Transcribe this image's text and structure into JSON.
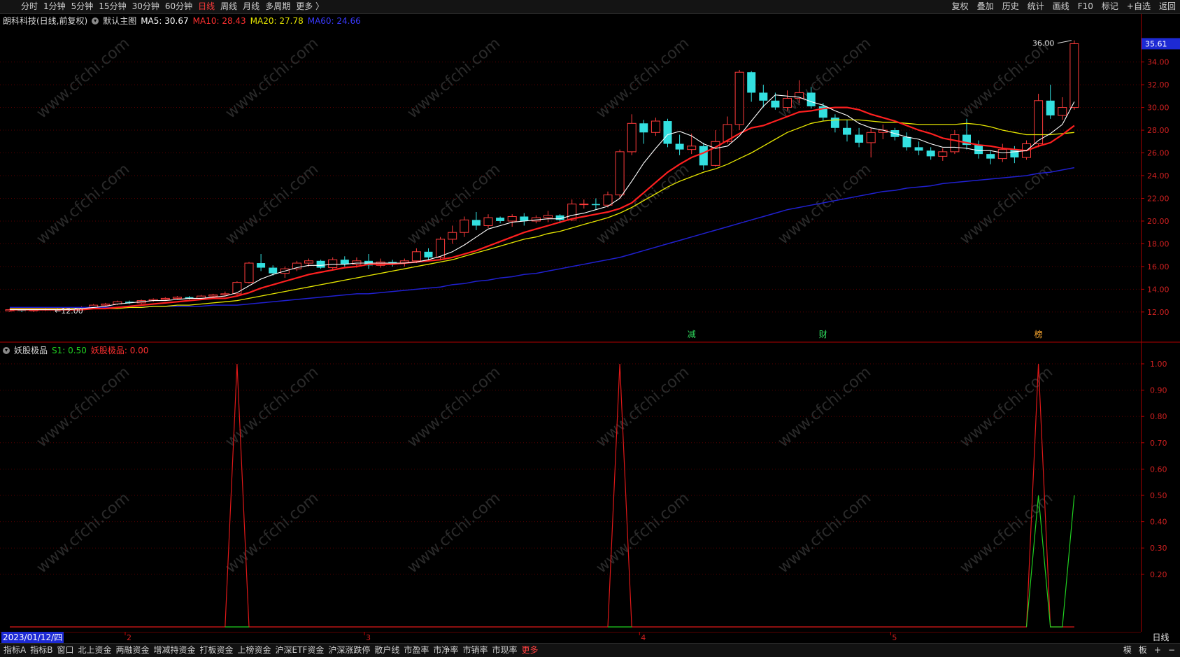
{
  "toolbar": {
    "periods": [
      "分时",
      "1分钟",
      "5分钟",
      "15分钟",
      "30分钟",
      "60分钟",
      "日线",
      "周线",
      "月线",
      "多周期",
      "更多 〉"
    ],
    "active_period": "日线",
    "actions": [
      "复权",
      "叠加",
      "历史",
      "统计",
      "画线",
      "F10",
      "标记",
      "+自选",
      "返回"
    ]
  },
  "main_header": {
    "stock": "朗科科技(日线,前复权)",
    "template": "默认主图",
    "ma5": "MA5: 30.67",
    "ma10": "MA10: 28.43",
    "ma20": "MA20: 27.78",
    "ma60": "MA60: 24.66"
  },
  "sub_header": {
    "name": "妖股极品",
    "s1": "S1: 0.50",
    "signal": "妖股极品: 0.00"
  },
  "price_axis": {
    "current": "35.61",
    "ticks": [
      "34.00",
      "32.00",
      "30.00",
      "28.00",
      "26.00",
      "24.00",
      "22.00",
      "20.00",
      "18.00",
      "16.00",
      "14.00",
      "12.00"
    ],
    "high_label": "36.00",
    "low_label": "12.00"
  },
  "sub_axis": {
    "ticks": [
      "1.00",
      "0.90",
      "0.80",
      "0.70",
      "0.60",
      "0.50",
      "0.40",
      "0.30",
      "0.20"
    ]
  },
  "events": [
    "减",
    "财",
    "榜"
  ],
  "date_axis": {
    "start": "2023/01/12/四",
    "months": [
      "2",
      "3",
      "4",
      "5"
    ],
    "period_button": "日线"
  },
  "bottom_tabs": [
    "指标A",
    "指标B",
    "窗口",
    "北上资金",
    "两融资金",
    "增减持资金",
    "打板资金",
    "上榜资金",
    "沪深ETF资金",
    "沪深涨跌停",
    "散户线",
    "市盈率",
    "市净率",
    "市销率",
    "市现率",
    "更多"
  ],
  "bottom_right": [
    "模",
    "板",
    "+",
    "−"
  ],
  "watermark": "www.cfchi.com",
  "colors": {
    "up": "#ff3b3b",
    "down": "#33e0e0",
    "ma5": "#ffffff",
    "ma10": "#ff2020",
    "ma20": "#e6e600",
    "ma60": "#2020d0"
  },
  "chart_data": [
    {
      "type": "candlestick",
      "title": "朗科科技(日线,前复权)",
      "ylim": [
        11.5,
        36.5
      ],
      "candles": [
        [
          12.1,
          12.2,
          12.0,
          12.3
        ],
        [
          12.2,
          12.1,
          12.0,
          12.3
        ],
        [
          12.1,
          12.2,
          12.0,
          12.3
        ],
        [
          12.2,
          12.3,
          12.1,
          12.4
        ],
        [
          12.3,
          12.2,
          12.1,
          12.4
        ],
        [
          12.2,
          12.3,
          12.1,
          12.4
        ],
        [
          12.3,
          12.4,
          12.2,
          12.5
        ],
        [
          12.4,
          12.6,
          12.3,
          12.7
        ],
        [
          12.6,
          12.7,
          12.5,
          12.8
        ],
        [
          12.7,
          12.9,
          12.6,
          13.0
        ],
        [
          12.9,
          12.8,
          12.7,
          13.0
        ],
        [
          12.8,
          13.0,
          12.7,
          13.1
        ],
        [
          13.0,
          13.1,
          12.9,
          13.2
        ],
        [
          13.1,
          13.2,
          13.0,
          13.3
        ],
        [
          13.2,
          13.3,
          13.1,
          13.4
        ],
        [
          13.3,
          13.2,
          13.1,
          13.4
        ],
        [
          13.2,
          13.4,
          13.1,
          13.5
        ],
        [
          13.4,
          13.5,
          13.3,
          13.6
        ],
        [
          13.5,
          13.6,
          13.4,
          13.8
        ],
        [
          13.6,
          14.6,
          13.5,
          14.7
        ],
        [
          14.6,
          16.3,
          14.5,
          16.4
        ],
        [
          16.3,
          15.9,
          15.6,
          17.1
        ],
        [
          15.9,
          15.4,
          15.2,
          16.1
        ],
        [
          15.4,
          15.8,
          15.0,
          16.0
        ],
        [
          15.8,
          16.3,
          15.6,
          16.5
        ],
        [
          16.3,
          16.5,
          16.0,
          16.7
        ],
        [
          16.5,
          15.9,
          15.8,
          16.6
        ],
        [
          15.9,
          16.6,
          15.7,
          16.8
        ],
        [
          16.6,
          16.2,
          16.0,
          16.9
        ],
        [
          16.2,
          16.5,
          15.9,
          16.8
        ],
        [
          16.5,
          16.1,
          15.8,
          17.1
        ],
        [
          16.1,
          16.4,
          15.9,
          16.7
        ],
        [
          16.4,
          16.3,
          16.0,
          16.6
        ],
        [
          16.3,
          16.5,
          16.0,
          16.7
        ],
        [
          16.5,
          17.3,
          16.3,
          17.6
        ],
        [
          17.3,
          16.8,
          16.5,
          17.6
        ],
        [
          16.8,
          18.4,
          16.6,
          18.6
        ],
        [
          18.4,
          19.0,
          18.0,
          19.6
        ],
        [
          19.0,
          20.1,
          18.6,
          20.4
        ],
        [
          20.1,
          19.6,
          19.2,
          20.8
        ],
        [
          19.6,
          20.3,
          19.4,
          20.6
        ],
        [
          20.3,
          20.0,
          19.8,
          20.4
        ],
        [
          20.0,
          20.4,
          19.5,
          20.6
        ],
        [
          20.4,
          20.0,
          19.6,
          20.7
        ],
        [
          20.0,
          20.3,
          19.8,
          20.5
        ],
        [
          20.3,
          20.5,
          19.9,
          20.9
        ],
        [
          20.5,
          20.1,
          19.8,
          20.6
        ],
        [
          20.1,
          21.5,
          20.0,
          21.9
        ],
        [
          21.5,
          21.5,
          21.1,
          21.9
        ],
        [
          21.5,
          21.4,
          21.0,
          22.0
        ],
        [
          21.4,
          22.3,
          21.2,
          22.6
        ],
        [
          22.3,
          26.1,
          22.0,
          26.3
        ],
        [
          26.1,
          28.6,
          25.8,
          29.4
        ],
        [
          28.6,
          27.8,
          26.8,
          28.9
        ],
        [
          27.8,
          28.8,
          27.5,
          29.1
        ],
        [
          28.8,
          26.8,
          26.5,
          29.0
        ],
        [
          26.8,
          26.3,
          25.8,
          27.6
        ],
        [
          26.3,
          26.6,
          25.9,
          27.7
        ],
        [
          26.6,
          24.9,
          24.5,
          26.9
        ],
        [
          24.9,
          27.0,
          24.8,
          28.0
        ],
        [
          27.0,
          28.5,
          26.8,
          29.2
        ],
        [
          28.5,
          33.1,
          28.0,
          33.3
        ],
        [
          33.1,
          31.3,
          30.5,
          33.2
        ],
        [
          31.3,
          30.6,
          30.0,
          32.0
        ],
        [
          30.6,
          30.0,
          29.8,
          31.3
        ],
        [
          30.0,
          30.8,
          29.7,
          31.5
        ],
        [
          30.8,
          31.3,
          30.4,
          32.4
        ],
        [
          31.3,
          30.1,
          29.9,
          31.8
        ],
        [
          30.1,
          29.1,
          28.8,
          30.4
        ],
        [
          29.1,
          28.2,
          27.8,
          29.4
        ],
        [
          28.2,
          27.6,
          27.0,
          28.9
        ],
        [
          27.6,
          26.9,
          26.5,
          28.2
        ],
        [
          26.9,
          27.8,
          25.6,
          28.2
        ],
        [
          27.8,
          28.0,
          27.2,
          28.5
        ],
        [
          28.0,
          27.4,
          27.1,
          28.2
        ],
        [
          27.4,
          26.5,
          26.2,
          27.8
        ],
        [
          26.5,
          26.2,
          25.8,
          27.0
        ],
        [
          26.2,
          25.7,
          25.4,
          26.5
        ],
        [
          25.7,
          26.1,
          25.3,
          26.4
        ],
        [
          26.1,
          27.6,
          25.9,
          28.0
        ],
        [
          27.6,
          26.7,
          26.3,
          29.0
        ],
        [
          26.7,
          25.9,
          25.5,
          27.1
        ],
        [
          25.9,
          25.5,
          25.0,
          26.2
        ],
        [
          25.5,
          26.3,
          25.2,
          26.8
        ],
        [
          26.3,
          25.6,
          25.1,
          26.6
        ],
        [
          25.6,
          26.8,
          25.4,
          27.1
        ],
        [
          26.8,
          30.6,
          26.5,
          31.2
        ],
        [
          30.6,
          29.3,
          29.0,
          32.0
        ],
        [
          29.3,
          30.0,
          28.9,
          30.9
        ],
        [
          30.0,
          35.61,
          29.8,
          35.9
        ]
      ],
      "ma5": [
        12.2,
        12.2,
        12.2,
        12.2,
        12.2,
        12.2,
        12.3,
        12.4,
        12.5,
        12.7,
        12.8,
        12.9,
        13.0,
        13.0,
        13.1,
        13.2,
        13.2,
        13.3,
        13.4,
        13.7,
        14.3,
        14.9,
        15.3,
        15.6,
        15.9,
        16.1,
        16.1,
        16.2,
        16.2,
        16.3,
        16.3,
        16.3,
        16.3,
        16.3,
        16.4,
        16.6,
        16.9,
        17.3,
        17.9,
        18.6,
        19.3,
        19.6,
        19.9,
        20.0,
        20.1,
        20.2,
        20.2,
        20.5,
        20.7,
        21.0,
        21.3,
        22.0,
        23.5,
        25.1,
        26.4,
        27.6,
        27.9,
        27.5,
        26.8,
        26.4,
        26.6,
        27.5,
        28.8,
        30.1,
        31.1,
        31.0,
        30.9,
        30.5,
        30.2,
        29.7,
        29.3,
        28.6,
        28.2,
        28.0,
        27.7,
        27.4,
        27.2,
        26.8,
        26.5,
        26.5,
        26.4,
        26.2,
        26.2,
        26.0,
        26.1,
        26.2,
        27.1,
        27.7,
        28.5,
        30.5
      ],
      "ma10": [
        12.2,
        12.2,
        12.2,
        12.2,
        12.2,
        12.2,
        12.2,
        12.3,
        12.3,
        12.4,
        12.5,
        12.6,
        12.7,
        12.8,
        12.9,
        13.0,
        13.1,
        13.2,
        13.2,
        13.4,
        13.7,
        14.1,
        14.4,
        14.7,
        15.0,
        15.3,
        15.5,
        15.7,
        15.9,
        16.0,
        16.2,
        16.2,
        16.2,
        16.3,
        16.4,
        16.5,
        16.6,
        16.8,
        17.1,
        17.4,
        17.8,
        18.2,
        18.6,
        19.0,
        19.3,
        19.6,
        19.9,
        20.2,
        20.4,
        20.6,
        20.8,
        21.1,
        21.6,
        22.5,
        23.4,
        24.3,
        25.0,
        25.6,
        26.0,
        26.5,
        27.1,
        27.7,
        28.2,
        28.4,
        28.8,
        29.2,
        29.6,
        29.7,
        29.9,
        30.0,
        30.0,
        29.8,
        29.4,
        29.1,
        28.8,
        28.4,
        28.0,
        27.7,
        27.3,
        27.1,
        26.9,
        26.7,
        26.6,
        26.4,
        26.3,
        26.2,
        26.6,
        26.9,
        27.6,
        28.4
      ],
      "ma20": [
        12.3,
        12.3,
        12.3,
        12.3,
        12.3,
        12.3,
        12.3,
        12.3,
        12.3,
        12.3,
        12.4,
        12.4,
        12.5,
        12.5,
        12.6,
        12.6,
        12.7,
        12.8,
        12.9,
        13.0,
        13.2,
        13.4,
        13.6,
        13.8,
        14.0,
        14.2,
        14.4,
        14.6,
        14.8,
        15.0,
        15.2,
        15.4,
        15.6,
        15.8,
        16.0,
        16.2,
        16.4,
        16.6,
        16.9,
        17.2,
        17.5,
        17.8,
        18.1,
        18.4,
        18.6,
        18.9,
        19.1,
        19.4,
        19.7,
        20.0,
        20.3,
        20.7,
        21.2,
        21.8,
        22.4,
        23.0,
        23.5,
        23.9,
        24.3,
        24.6,
        25.0,
        25.5,
        26.0,
        26.6,
        27.2,
        27.8,
        28.2,
        28.6,
        28.8,
        28.9,
        28.9,
        28.9,
        28.8,
        28.7,
        28.7,
        28.6,
        28.5,
        28.5,
        28.5,
        28.5,
        28.6,
        28.5,
        28.3,
        28.0,
        27.8,
        27.6,
        27.6,
        27.6,
        27.7,
        27.8
      ],
      "ma60": [
        12.4,
        12.4,
        12.4,
        12.4,
        12.4,
        12.4,
        12.4,
        12.4,
        12.4,
        12.4,
        12.4,
        12.4,
        12.5,
        12.5,
        12.5,
        12.5,
        12.5,
        12.6,
        12.6,
        12.6,
        12.7,
        12.8,
        12.9,
        13.0,
        13.1,
        13.2,
        13.3,
        13.4,
        13.5,
        13.6,
        13.6,
        13.7,
        13.8,
        13.9,
        14.0,
        14.1,
        14.2,
        14.4,
        14.5,
        14.7,
        14.8,
        15.0,
        15.1,
        15.3,
        15.4,
        15.6,
        15.8,
        16.0,
        16.2,
        16.4,
        16.6,
        16.8,
        17.1,
        17.4,
        17.7,
        18.0,
        18.3,
        18.6,
        18.9,
        19.2,
        19.5,
        19.8,
        20.1,
        20.4,
        20.7,
        21.0,
        21.2,
        21.4,
        21.6,
        21.8,
        22.0,
        22.2,
        22.4,
        22.6,
        22.7,
        22.9,
        23.0,
        23.1,
        23.3,
        23.4,
        23.5,
        23.6,
        23.7,
        23.8,
        23.9,
        24.0,
        24.2,
        24.3,
        24.5,
        24.7
      ]
    },
    {
      "type": "line",
      "title": "妖股极品",
      "ylim": [
        0,
        1.05
      ],
      "series": [
        {
          "name": "妖股极品",
          "spikes_at_bar_index": [
            19,
            51,
            86
          ],
          "values_at_spikes": [
            1.0,
            1.0,
            1.0
          ],
          "baseline": 0.0
        },
        {
          "name": "S1",
          "spikes_at_bar_index": [
            86,
            89
          ],
          "values_at_spikes": [
            0.5,
            0.5
          ],
          "baseline": 0.0
        }
      ]
    }
  ]
}
